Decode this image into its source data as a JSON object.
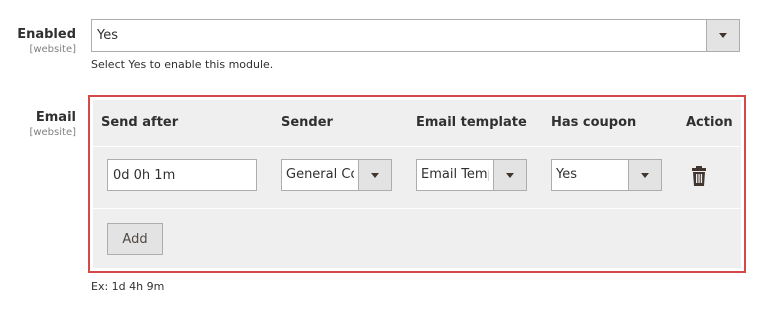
{
  "enabled": {
    "label": "Enabled",
    "scope": "[website]",
    "value": "Yes",
    "note": "Select Yes to enable this module."
  },
  "email": {
    "label": "Email",
    "scope": "[website]",
    "columns": [
      "Send after",
      "Sender",
      "Email template",
      "Has coupon",
      "Action"
    ],
    "rows": [
      {
        "send_after": "0d 0h 1m",
        "sender": "General Contact",
        "template": "Email Template",
        "has_coupon": "Yes",
        "action_icon": "trash-icon"
      }
    ],
    "add_label": "Add",
    "note": "Ex: 1d 4h 9m"
  },
  "colors": {
    "highlight_border": "#d44a4a",
    "grid_bg": "#efefef",
    "control_border": "#adadad"
  }
}
